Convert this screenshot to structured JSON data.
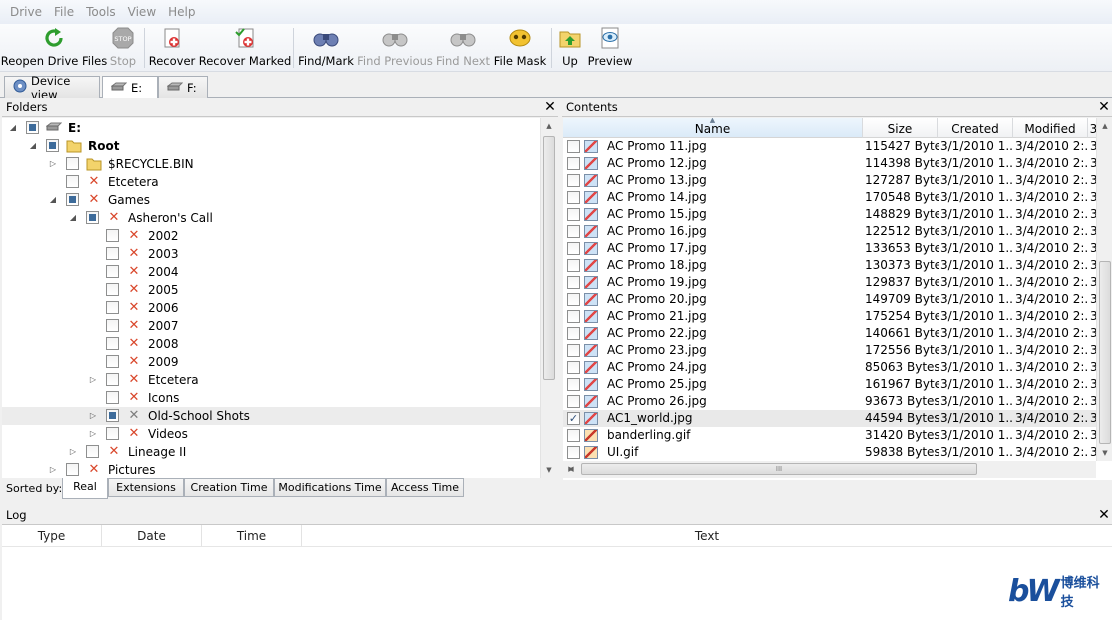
{
  "menu": [
    "Drive",
    "File",
    "Tools",
    "View",
    "Help"
  ],
  "toolbar": {
    "buttons": [
      {
        "label": "Reopen Drive Files",
        "icon": "reopen-icon",
        "enabled": true
      },
      {
        "label": "Stop",
        "icon": "stop-icon",
        "enabled": false
      },
      {
        "label": "Recover",
        "icon": "recover-icon",
        "enabled": true
      },
      {
        "label": "Recover Marked",
        "icon": "recover-marked-icon",
        "enabled": true
      },
      {
        "label": "Find/Mark",
        "icon": "binoculars-icon",
        "enabled": true
      },
      {
        "label": "Find Previous",
        "icon": "binoculars-icon",
        "enabled": false
      },
      {
        "label": "Find Next",
        "icon": "binoculars-icon",
        "enabled": false
      },
      {
        "label": "File Mask",
        "icon": "file-mask-icon",
        "enabled": true
      },
      {
        "label": "Up",
        "icon": "folder-up-icon",
        "enabled": true
      },
      {
        "label": "Preview",
        "icon": "preview-eye-icon",
        "enabled": true
      }
    ]
  },
  "drive_tabs": [
    {
      "label": "Device view",
      "icon": "device-icon",
      "active": false
    },
    {
      "label": "E:",
      "icon": "drive-icon",
      "active": true
    },
    {
      "label": "F:",
      "icon": "drive-icon",
      "active": false
    }
  ],
  "folders": {
    "title": "Folders",
    "close": "✕",
    "tree": [
      {
        "label": "E:",
        "bold": true,
        "icon": "drive-icon",
        "check": "partial",
        "expander": "expanded",
        "level": 0
      },
      {
        "label": "Root",
        "bold": true,
        "icon": "folder-icon",
        "check": "partial",
        "expander": "expanded",
        "level": 1
      },
      {
        "label": "$RECYCLE.BIN",
        "icon": "folder-icon",
        "check": "none",
        "expander": "collapsed",
        "level": 2
      },
      {
        "label": "Etcetera",
        "icon": "deleted-icon",
        "check": "none",
        "expander": "",
        "level": 2
      },
      {
        "label": "Games",
        "icon": "deleted-icon",
        "check": "partial",
        "expander": "expanded",
        "level": 2
      },
      {
        "label": "Asheron's Call",
        "icon": "deleted-icon",
        "check": "partial",
        "expander": "expanded",
        "level": 3
      },
      {
        "label": "2002",
        "icon": "deleted-icon",
        "check": "none",
        "expander": "",
        "level": 4
      },
      {
        "label": "2003",
        "icon": "deleted-icon",
        "check": "none",
        "expander": "",
        "level": 4
      },
      {
        "label": "2004",
        "icon": "deleted-icon",
        "check": "none",
        "expander": "",
        "level": 4
      },
      {
        "label": "2005",
        "icon": "deleted-icon",
        "check": "none",
        "expander": "",
        "level": 4
      },
      {
        "label": "2006",
        "icon": "deleted-icon",
        "check": "none",
        "expander": "",
        "level": 4
      },
      {
        "label": "2007",
        "icon": "deleted-icon",
        "check": "none",
        "expander": "",
        "level": 4
      },
      {
        "label": "2008",
        "icon": "deleted-icon",
        "check": "none",
        "expander": "",
        "level": 4
      },
      {
        "label": "2009",
        "icon": "deleted-icon",
        "check": "none",
        "expander": "",
        "level": 4
      },
      {
        "label": "Etcetera",
        "icon": "deleted-icon",
        "check": "none",
        "expander": "collapsed",
        "level": 4
      },
      {
        "label": "Icons",
        "icon": "deleted-icon",
        "check": "none",
        "expander": "",
        "level": 4
      },
      {
        "label": "Old-School Shots",
        "icon": "deleted-gray-icon",
        "check": "partial",
        "expander": "collapsed",
        "level": 4,
        "selected": true
      },
      {
        "label": "Videos",
        "icon": "deleted-icon",
        "check": "none",
        "expander": "collapsed",
        "level": 4
      },
      {
        "label": "Lineage II",
        "icon": "deleted-icon",
        "check": "none",
        "expander": "collapsed",
        "level": 3
      },
      {
        "label": "Pictures",
        "icon": "deleted-icon",
        "check": "none",
        "expander": "collapsed",
        "level": 2
      }
    ]
  },
  "sort": {
    "label": "Sorted by:",
    "tabs": [
      {
        "label": "Real",
        "active": true
      },
      {
        "label": "Extensions",
        "active": false
      },
      {
        "label": "Creation Time",
        "active": false
      },
      {
        "label": "Modifications Time",
        "active": false
      },
      {
        "label": "Access Time",
        "active": false
      }
    ]
  },
  "contents": {
    "title": "Contents",
    "close": "✕",
    "columns": [
      "Name",
      "Size",
      "Created",
      "Modified",
      "3"
    ],
    "rows": [
      {
        "name": "AC Promo 11.jpg",
        "size": "115427 Bytes",
        "created": "3/1/2010 1...",
        "modified": "3/4/2010 2:...",
        "extra": "3",
        "checked": false,
        "type": "jpg"
      },
      {
        "name": "AC Promo 12.jpg",
        "size": "114398 Bytes",
        "created": "3/1/2010 1...",
        "modified": "3/4/2010 2:...",
        "extra": "3",
        "checked": false,
        "type": "jpg"
      },
      {
        "name": "AC Promo 13.jpg",
        "size": "127287 Bytes",
        "created": "3/1/2010 1...",
        "modified": "3/4/2010 2:...",
        "extra": "3",
        "checked": false,
        "type": "jpg"
      },
      {
        "name": "AC Promo 14.jpg",
        "size": "170548 Bytes",
        "created": "3/1/2010 1...",
        "modified": "3/4/2010 2:...",
        "extra": "3",
        "checked": false,
        "type": "jpg"
      },
      {
        "name": "AC Promo 15.jpg",
        "size": "148829 Bytes",
        "created": "3/1/2010 1...",
        "modified": "3/4/2010 2:...",
        "extra": "3",
        "checked": false,
        "type": "jpg"
      },
      {
        "name": "AC Promo 16.jpg",
        "size": "122512 Bytes",
        "created": "3/1/2010 1...",
        "modified": "3/4/2010 2:...",
        "extra": "3",
        "checked": false,
        "type": "jpg"
      },
      {
        "name": "AC Promo 17.jpg",
        "size": "133653 Bytes",
        "created": "3/1/2010 1...",
        "modified": "3/4/2010 2:...",
        "extra": "3",
        "checked": false,
        "type": "jpg"
      },
      {
        "name": "AC Promo 18.jpg",
        "size": "130373 Bytes",
        "created": "3/1/2010 1...",
        "modified": "3/4/2010 2:...",
        "extra": "3",
        "checked": false,
        "type": "jpg"
      },
      {
        "name": "AC Promo 19.jpg",
        "size": "129837 Bytes",
        "created": "3/1/2010 1...",
        "modified": "3/4/2010 2:...",
        "extra": "3",
        "checked": false,
        "type": "jpg"
      },
      {
        "name": "AC Promo 20.jpg",
        "size": "149709 Bytes",
        "created": "3/1/2010 1...",
        "modified": "3/4/2010 2:...",
        "extra": "3",
        "checked": false,
        "type": "jpg"
      },
      {
        "name": "AC Promo 21.jpg",
        "size": "175254 Bytes",
        "created": "3/1/2010 1...",
        "modified": "3/4/2010 2:...",
        "extra": "3",
        "checked": false,
        "type": "jpg"
      },
      {
        "name": "AC Promo 22.jpg",
        "size": "140661 Bytes",
        "created": "3/1/2010 1...",
        "modified": "3/4/2010 2:...",
        "extra": "3",
        "checked": false,
        "type": "jpg"
      },
      {
        "name": "AC Promo 23.jpg",
        "size": "172556 Bytes",
        "created": "3/1/2010 1...",
        "modified": "3/4/2010 2:...",
        "extra": "3",
        "checked": false,
        "type": "jpg"
      },
      {
        "name": "AC Promo 24.jpg",
        "size": "85063 Bytes",
        "created": "3/1/2010 1...",
        "modified": "3/4/2010 2:...",
        "extra": "3",
        "checked": false,
        "type": "jpg"
      },
      {
        "name": "AC Promo 25.jpg",
        "size": "161967 Bytes",
        "created": "3/1/2010 1...",
        "modified": "3/4/2010 2:...",
        "extra": "3",
        "checked": false,
        "type": "jpg"
      },
      {
        "name": "AC Promo 26.jpg",
        "size": "93673 Bytes",
        "created": "3/1/2010 1...",
        "modified": "3/4/2010 2:...",
        "extra": "3",
        "checked": false,
        "type": "jpg"
      },
      {
        "name": "AC1_world.jpg",
        "size": "44594 Bytes",
        "created": "3/1/2010 1...",
        "modified": "3/4/2010 2:...",
        "extra": "3",
        "checked": true,
        "type": "jpg",
        "selected": true
      },
      {
        "name": "banderling.gif",
        "size": "31420 Bytes",
        "created": "3/1/2010 1...",
        "modified": "3/4/2010 2:...",
        "extra": "3",
        "checked": false,
        "type": "gif"
      },
      {
        "name": "UI.gif",
        "size": "59838 Bytes",
        "created": "3/1/2010 1...",
        "modified": "3/4/2010 2:...",
        "extra": "3",
        "checked": false,
        "type": "gif"
      }
    ],
    "hscroll_grip": "III"
  },
  "log": {
    "title": "Log",
    "close": "✕",
    "columns": [
      "Type",
      "Date",
      "Time",
      "Text"
    ]
  },
  "watermark": {
    "mark": "bW",
    "text": "博维科技"
  },
  "colors": {
    "accent": "#3d6b9a",
    "deleted": "#d9472b",
    "logo": "#1a4f9c"
  }
}
